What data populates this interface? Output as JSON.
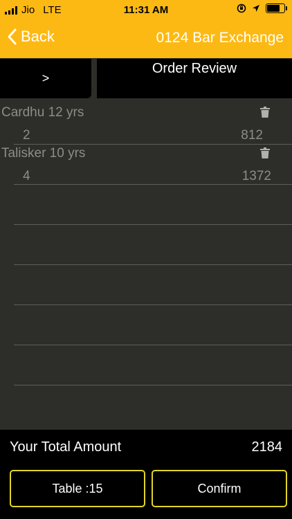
{
  "status": {
    "carrier": "Jio",
    "network": "LTE",
    "time": "11:31 AM",
    "battery_level": 0.85
  },
  "nav": {
    "back_label": "Back",
    "title": "0124 Bar Exchange"
  },
  "segments": {
    "left_label": ">",
    "right_label": "Order Review"
  },
  "items": [
    {
      "name": "Cardhu 12 yrs",
      "qty": "2",
      "amount": "812"
    },
    {
      "name": "Talisker 10 yrs",
      "qty": "4",
      "amount": "1372"
    }
  ],
  "total": {
    "label": "Your Total Amount",
    "value": "2184"
  },
  "buttons": {
    "table_label": "Table :15",
    "confirm_label": "Confirm"
  },
  "colors": {
    "accent": "#fdb913",
    "button_border": "#e2d62a",
    "background": "#2d2e29"
  }
}
